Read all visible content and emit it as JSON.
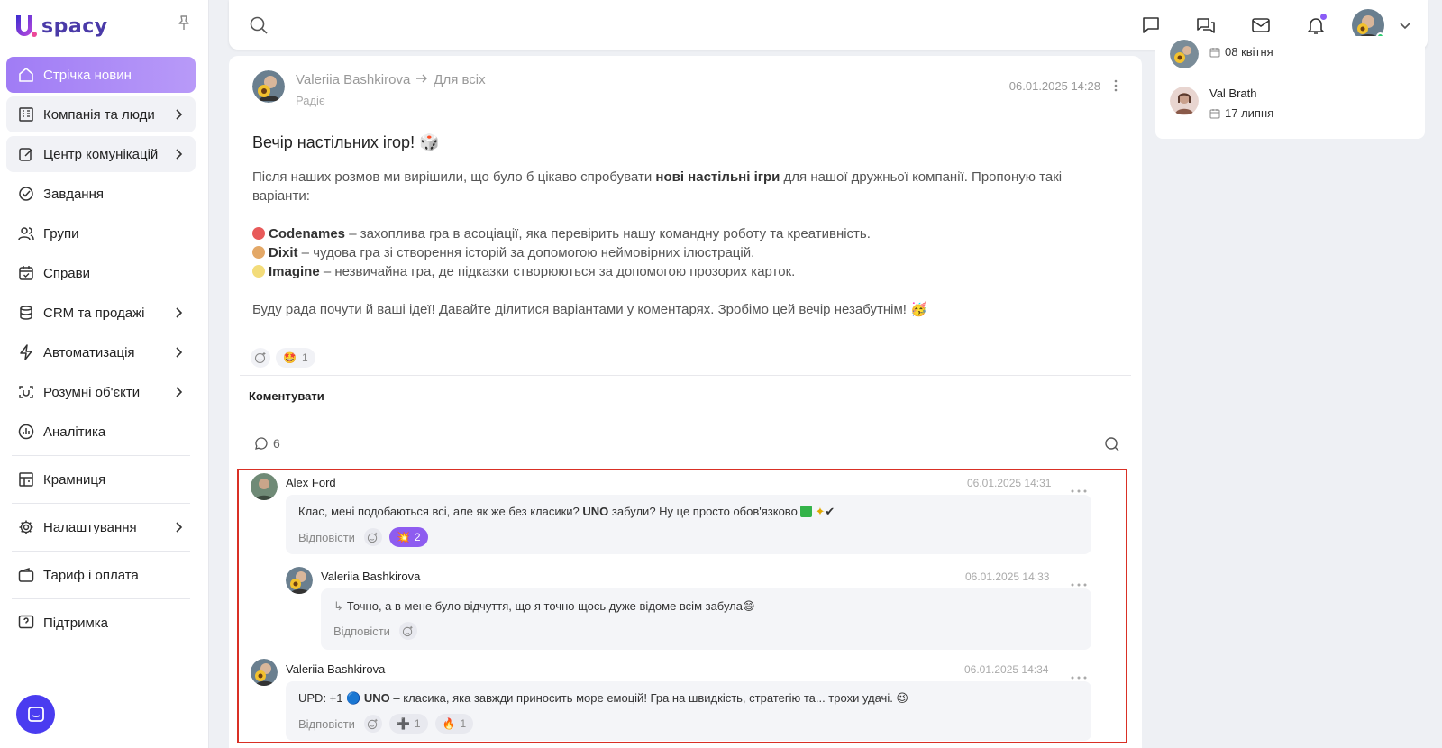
{
  "app": {
    "brand_name": "spacy",
    "brand_color": "#4a3aa8",
    "accent": "#a07cf5"
  },
  "sidebar": {
    "items": [
      {
        "label": "Стрічка новин",
        "icon": "home-icon",
        "active": true,
        "chevron": false
      },
      {
        "label": "Компанія та люди",
        "icon": "building-icon",
        "chevron": true
      },
      {
        "label": "Центр комунікацій",
        "icon": "edit-icon",
        "chevron": true
      },
      {
        "label": "Завдання",
        "icon": "check-circle-icon",
        "chevron": false
      },
      {
        "label": "Групи",
        "icon": "users-icon",
        "chevron": false
      },
      {
        "label": "Справи",
        "icon": "calendar-icon",
        "chevron": false
      },
      {
        "label": "CRM та продажі",
        "icon": "database-icon",
        "chevron": true
      },
      {
        "label": "Автоматизація",
        "icon": "bolt-icon",
        "chevron": true
      },
      {
        "label": "Розумні об'єкти",
        "icon": "scan-icon",
        "chevron": true
      },
      {
        "label": "Аналітика",
        "icon": "chart-icon",
        "chevron": false
      },
      {
        "label": "Крамниця",
        "icon": "store-icon",
        "chevron": false
      },
      {
        "label": "Налаштування",
        "icon": "gear-icon",
        "chevron": true
      },
      {
        "label": "Тариф і оплата",
        "icon": "wallet-icon",
        "chevron": false
      },
      {
        "label": "Підтримка",
        "icon": "help-icon",
        "chevron": false
      }
    ]
  },
  "right_panel": {
    "birthdays": [
      {
        "date": "08 квітня"
      },
      {
        "name": "Val Brath",
        "date": "17 липня"
      }
    ]
  },
  "post": {
    "author": "Valeriia Bashkirova",
    "audience": "Для всіх",
    "subtitle": "Радіє",
    "date": "06.01.2025 14:28",
    "title": "Вечір настільних ігор! 🎲",
    "intro_1": "Після наших розмов ми вирішили, що було б цікаво спробувати ",
    "intro_bold": "нові настільні ігри",
    "intro_2": " для нашої дружньої компанії. Пропоную такі",
    "intro_3": "варіанти:",
    "games": [
      {
        "name": "Codenames",
        "desc": " – захоплива гра в асоціації, яка перевірить нашу командну роботу та креативність."
      },
      {
        "name": "Dixit",
        "desc": " – чудова гра зі створення історій за допомогою неймовірних ілюстрацій."
      },
      {
        "name": "Imagine",
        "desc": " – незвичайна гра, де підказки створюються за допомогою прозорих карток."
      }
    ],
    "outro": "Буду рада почути й ваші ідеї! Давайте ділитися варіантами у коментарях. Зробімо цей вечір незабутнім! 🥳",
    "reaction_emoji": "🤩",
    "reaction_count": "1",
    "comment_label": "Коментувати",
    "comment_count": "6"
  },
  "comments": [
    {
      "author": "Alex Ford",
      "date": "06.01.2025 14:31",
      "text_1": "Клас, мені подобаються всі, але як же без класики? ",
      "text_bold": "UNO",
      "text_2": " забули? Ну це просто обов'язково",
      "reply_label": "Відповісти",
      "reaction_emoji": "💥",
      "reaction_count": "2"
    },
    {
      "author": "Valeriia Bashkirova",
      "date": "06.01.2025 14:33",
      "text": "Точно, а в мене було відчуття, що я точно щось дуже відоме всім забула😄",
      "reply_label": "Відповісти"
    },
    {
      "author": "Valeriia Bashkirova",
      "date": "06.01.2025 14:34",
      "text_1": "UPD: +1 🔵 ",
      "text_bold": "UNO",
      "text_2": "  – класика, яка завжди приносить море емоцій! Гра на швидкість, стратегію та... трохи удачі. 😉",
      "reply_label": "Відповісти",
      "reactions": [
        {
          "emoji": "➕",
          "count": "1"
        },
        {
          "emoji": "🔥",
          "count": "1"
        }
      ]
    }
  ]
}
